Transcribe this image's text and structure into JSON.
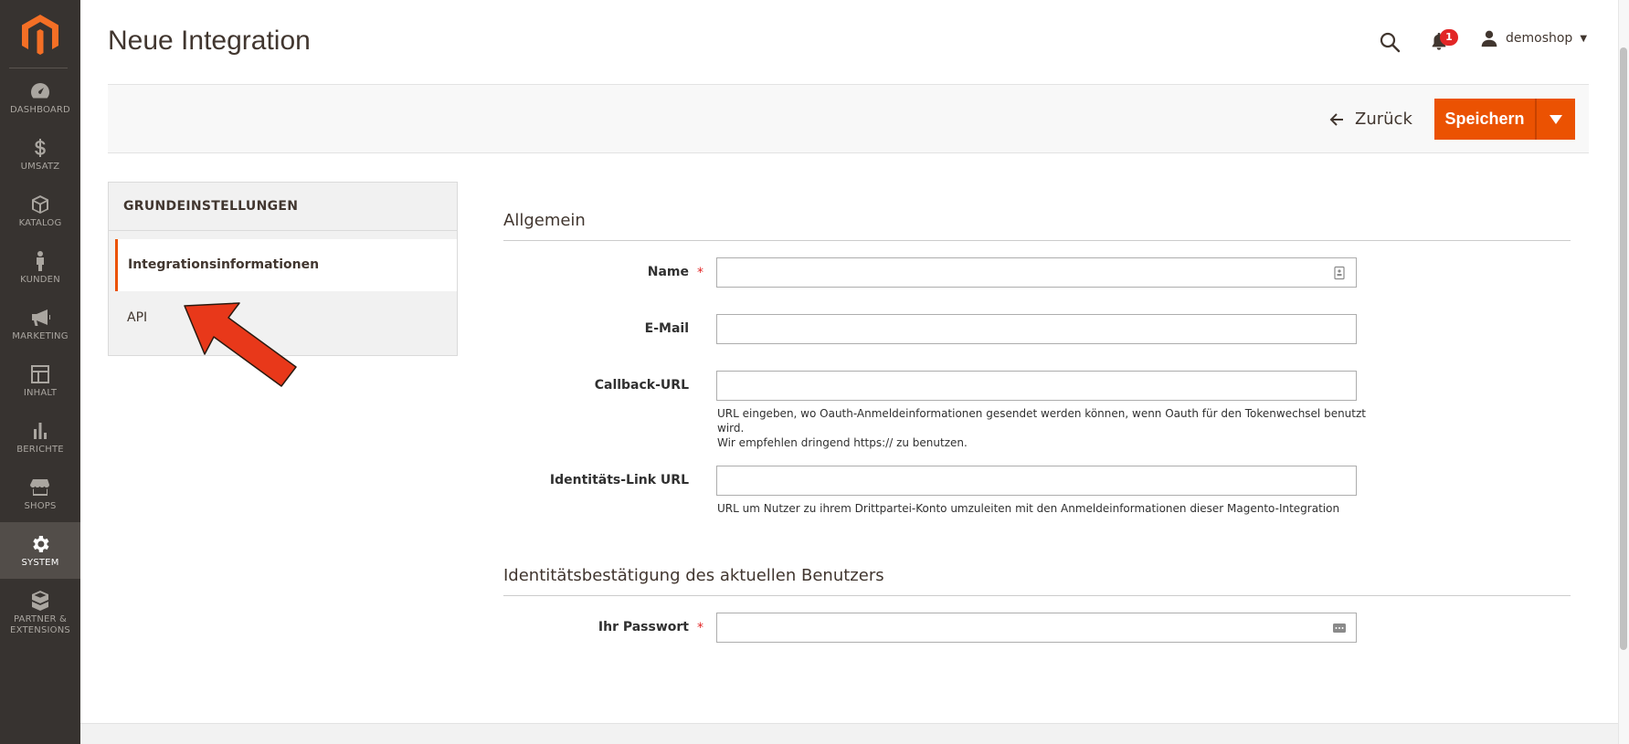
{
  "sidebar": {
    "logo_icon": "magento-logo-icon",
    "items": [
      {
        "label": "DASHBOARD",
        "icon": "dashboard-icon"
      },
      {
        "label": "UMSATZ",
        "icon": "dollar-icon"
      },
      {
        "label": "KATALOG",
        "icon": "box-icon"
      },
      {
        "label": "KUNDEN",
        "icon": "person-icon"
      },
      {
        "label": "MARKETING",
        "icon": "megaphone-icon"
      },
      {
        "label": "INHALT",
        "icon": "layout-icon"
      },
      {
        "label": "BERICHTE",
        "icon": "bar-chart-icon"
      },
      {
        "label": "SHOPS",
        "icon": "store-icon"
      },
      {
        "label": "SYSTEM",
        "icon": "gear-icon",
        "active": true
      },
      {
        "label": "PARTNER &",
        "label2": "EXTENSIONS",
        "icon": "boxes-icon"
      }
    ]
  },
  "header": {
    "title": "Neue Integration",
    "notifications_count": "1",
    "user_name": "demoshop"
  },
  "actions": {
    "back_label": "Zurück",
    "save_label": "Speichern"
  },
  "tabs": {
    "heading": "GRUNDEINSTELLUNGEN",
    "items": [
      {
        "label": "Integrationsinformationen",
        "active": true
      },
      {
        "label": "API",
        "active": false
      }
    ]
  },
  "form": {
    "section_general": "Allgemein",
    "name_label": "Name",
    "email_label": "E-Mail",
    "callback_label": "Callback-URL",
    "callback_note_1": "URL eingeben, wo Oauth-Anmeldeinformationen gesendet werden können, wenn Oauth für den Tokenwechsel benutzt wird.",
    "callback_note_2": "Wir empfehlen dringend https:// zu benutzen.",
    "identity_label": "Identitäts-Link URL",
    "identity_note": "URL um Nutzer zu ihrem Drittpartei-Konto umzuleiten mit den Anmeldeinformationen dieser Magento-Integration",
    "section_identity": "Identitätsbestätigung des aktuellen Benutzers",
    "password_label": "Ihr Passwort",
    "required_mark": "*"
  },
  "colors": {
    "accent": "#eb5202",
    "sidebar_bg": "#373330",
    "annotation_arrow": "#e8381a"
  }
}
